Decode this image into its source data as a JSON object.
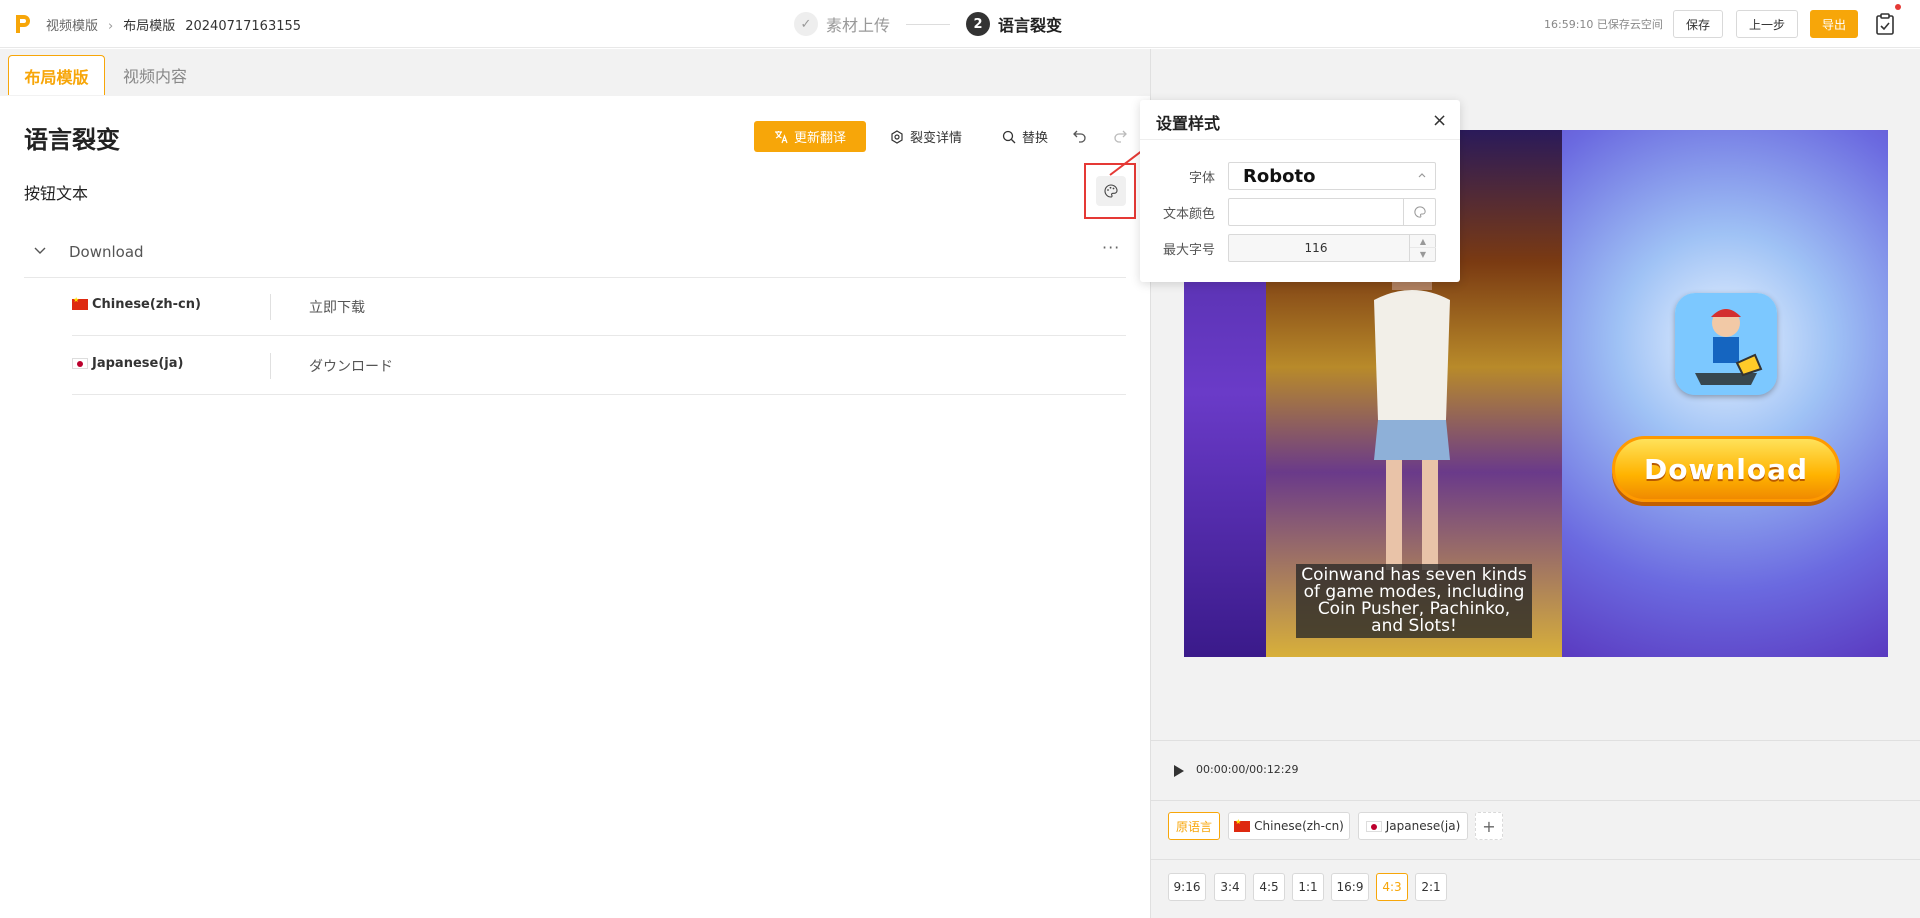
{
  "header": {
    "breadcrumb": {
      "root": "视频模版",
      "current": "布局模版",
      "project_id": "20240717163155"
    },
    "steps": [
      {
        "num": "✓",
        "label": "素材上传",
        "state": "done"
      },
      {
        "num": "2",
        "label": "语言裂变",
        "state": "active"
      }
    ],
    "save_status": "16:59:10 已保存云空间",
    "buttons": {
      "save": "保存",
      "prev": "上一步",
      "export": "导出"
    }
  },
  "tabs": [
    {
      "label": "布局模版",
      "active": true
    },
    {
      "label": "视频内容",
      "active": false
    }
  ],
  "panel": {
    "title": "语言裂变",
    "update_btn": "更新翻译",
    "detail_btn": "裂变详情",
    "replace_btn": "替换",
    "section": "按钮文本",
    "group": {
      "label": "Download",
      "more": "···"
    },
    "rows": [
      {
        "lang": "Chinese(zh-cn)",
        "flag": "cn",
        "value": "立即下载"
      },
      {
        "lang": "Japanese(ja)",
        "flag": "jp",
        "value": "ダウンロード"
      }
    ]
  },
  "popup": {
    "title": "设置样式",
    "close": "×",
    "font_label": "字体",
    "font_value": "Roboto",
    "color_label": "文本颜色",
    "color_value": "",
    "max_size_label": "最大字号",
    "max_size_value": "116"
  },
  "preview": {
    "download_text": "Download",
    "caption": "Coinwand has seven kinds of game modes, including Coin Pusher, Pachinko, and Slots!"
  },
  "player": {
    "time": "00:00:00/00:12:29"
  },
  "lang_tabs": [
    {
      "label": "原语言",
      "flag": "",
      "active": true
    },
    {
      "label": "Chinese(zh-cn)",
      "flag": "cn",
      "active": false
    },
    {
      "label": "Japanese(ja)",
      "flag": "jp",
      "active": false
    }
  ],
  "add_label": "+",
  "ratios": [
    {
      "label": "9:16",
      "active": false
    },
    {
      "label": "3:4",
      "active": false
    },
    {
      "label": "4:5",
      "active": false
    },
    {
      "label": "1:1",
      "active": false
    },
    {
      "label": "16:9",
      "active": false
    },
    {
      "label": "4:3",
      "active": true
    },
    {
      "label": "2:1",
      "active": false
    }
  ],
  "colors": {
    "accent": "#f7a609",
    "highlight": "#e53935"
  }
}
